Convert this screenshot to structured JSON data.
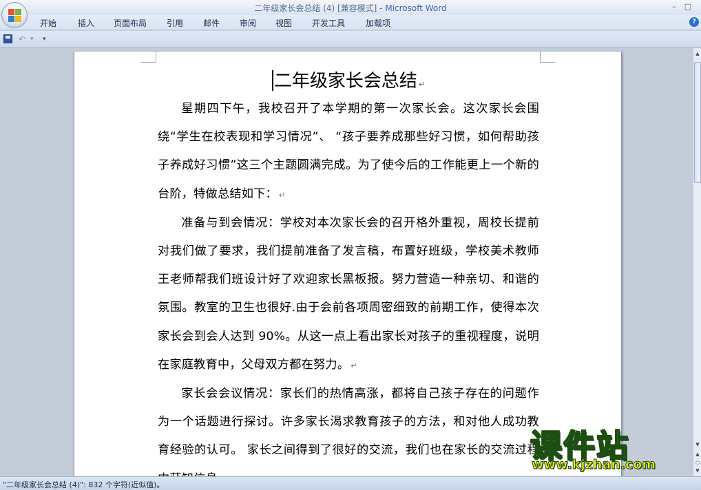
{
  "window": {
    "title_doc": "二年级家长会总结 (4) [兼容模式] - ",
    "title_app": "Microsoft Word",
    "minimize": "–",
    "maximize": "□",
    "help": "?"
  },
  "ribbon": {
    "tabs": [
      "开始",
      "插入",
      "页面布局",
      "引用",
      "邮件",
      "审阅",
      "视图",
      "开发工具",
      "加载项"
    ]
  },
  "qat": {
    "undo": "↶",
    "undo_dropdown": "▾",
    "customize": "▾"
  },
  "document": {
    "title": "二年级家长会总结",
    "paragraph_mark": "↵",
    "paragraphs": [
      "星期四下午，我校召开了本学期的第一次家长会。这次家长会围绕“学生在校表现和学习情况”、 “孩子要养成那些好习惯，如何帮助孩子养成好习惯”这三个主题圆满完成。为了使今后的工作能更上一个新的台阶，特做总结如下：",
      "准备与到会情况：学校对本次家长会的召开格外重视，周校长提前对我们做了要求，我们提前准备了发言稿，布置好班级，学校美术教师王老师帮我们班设计好了欢迎家长黑板报。努力营造一种亲切、和谐的氛围。教室的卫生也很好.由于会前各项周密细致的前期工作，使得本次家长会到会人达到 90%。从这一点上看出家长对孩子的重视程度，说明在家庭教育中，父母双方都在努力。",
      "家长会会议情况：家长们的热情高涨，都将自己孩子存在的问题作为一个话题进行探讨。许多家长渴求教育孩子的方法，和对他人成功教育经验的认可。 家长之间得到了很好的交流，我们也在家长的交流过程中获知信息"
    ]
  },
  "statusbar": {
    "text": "\"二年级家长会总结 (4)\": 832 个字符(近似值)。"
  },
  "watermark": {
    "text": "课件站",
    "url": "www.kjzhan.com"
  },
  "colors": {
    "title_app": "#3a66b2",
    "watermark_fill": "#f4ee0e",
    "watermark_stroke": "#1d4e12"
  }
}
